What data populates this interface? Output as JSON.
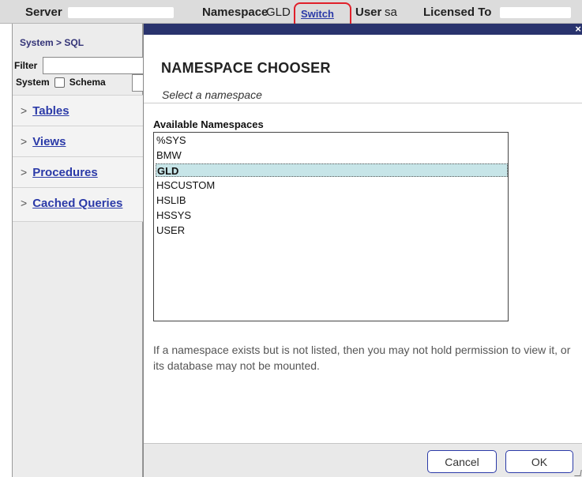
{
  "header": {
    "server_label": "Server",
    "namespace_label": "Namespace",
    "namespace_value": "GLD",
    "switch_label": "Switch",
    "user_label": "User",
    "user_value": "sa",
    "licensed_label": "Licensed To"
  },
  "sidebar": {
    "breadcrumb": "System > SQL",
    "filter_label": "Filter",
    "system_label": "System",
    "schema_label": "Schema",
    "items": [
      {
        "label": "Tables"
      },
      {
        "label": "Views"
      },
      {
        "label": "Procedures"
      },
      {
        "label": "Cached Queries"
      }
    ]
  },
  "dialog": {
    "title": "NAMESPACE CHOOSER",
    "subtitle": "Select a namespace",
    "list_label": "Available Namespaces",
    "namespaces": [
      "%SYS",
      "BMW",
      "GLD",
      "HSCUSTOM",
      "HSLIB",
      "HSSYS",
      "USER"
    ],
    "selected": "GLD",
    "note": "If a namespace exists but is not listed, then you may not hold permission to view it, or its database may not be mounted.",
    "cancel_label": "Cancel",
    "ok_label": "OK",
    "close_icon": "×"
  },
  "colors": {
    "titlebar": "#29336d",
    "link": "#2b3aa8",
    "selection": "#c7e5e8",
    "highlight_ring": "#e0202a"
  }
}
